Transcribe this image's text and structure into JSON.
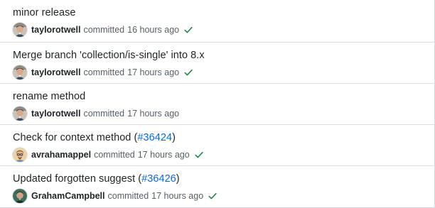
{
  "commits": [
    {
      "title": "minor release",
      "issue": "",
      "title_suffix": "",
      "author": "taylorotwell",
      "committed": "committed",
      "time": "16 hours ago",
      "status_icon": "check-icon",
      "avatar": "taylorotwell-avatar"
    },
    {
      "title": "Merge branch 'collection/is-single' into 8.x",
      "issue": "",
      "title_suffix": "",
      "author": "taylorotwell",
      "committed": "committed",
      "time": "17 hours ago",
      "status_icon": "check-icon",
      "avatar": "taylorotwell-avatar"
    },
    {
      "title": "rename method",
      "issue": "",
      "title_suffix": "",
      "author": "taylorotwell",
      "committed": "committed",
      "time": "17 hours ago",
      "status_icon": "",
      "avatar": "taylorotwell-avatar"
    },
    {
      "title": "Check for context method (",
      "issue": "#36424",
      "title_suffix": ")",
      "author": "avrahamappel",
      "committed": "committed",
      "time": "17 hours ago",
      "status_icon": "check-icon",
      "avatar": "avrahamappel-avatar"
    },
    {
      "title": "Updated forgotten suggest (",
      "issue": "#36426",
      "title_suffix": ")",
      "author": "GrahamCampbell",
      "committed": "committed",
      "time": "17 hours ago",
      "status_icon": "check-icon",
      "avatar": "grahamcampbell-avatar"
    }
  ],
  "colors": {
    "link": "#0969da",
    "success": "#1a7f37",
    "muted": "#57606a",
    "text": "#1f2328",
    "divider": "#d8dee4"
  }
}
